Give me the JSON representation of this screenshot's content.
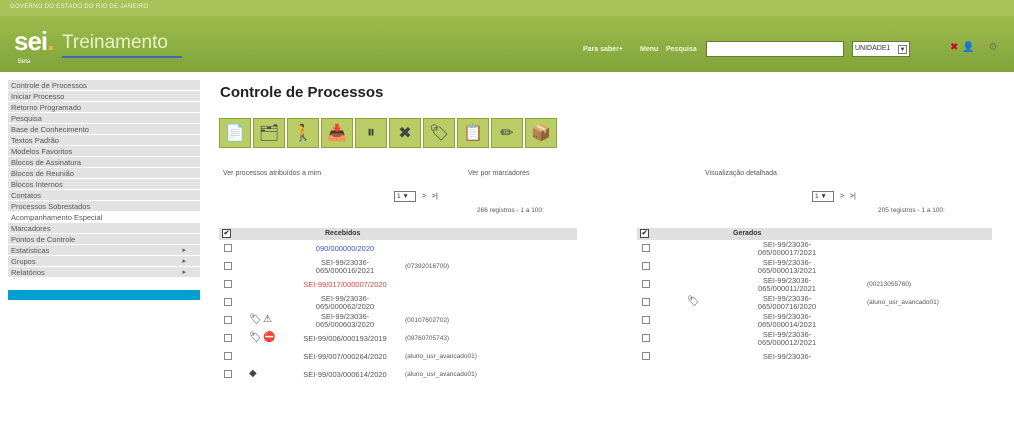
{
  "header": {
    "top_strip_text": "GOVERNO DO ESTADO DO RIO DE JANEIRO",
    "logo": "sei",
    "logo_dot": ".",
    "app_name": "Treinamento",
    "env": "Beta",
    "links": [
      "Para saber+",
      "Menu",
      "Pesquisa"
    ],
    "search": {
      "value": "",
      "placeholder": ""
    },
    "unit": "UNIDADE1",
    "icons": [
      "close-icon",
      "user-icon",
      "help-icon",
      "settings-icon"
    ]
  },
  "sidebar": {
    "items": [
      {
        "label": "Controle de Processos",
        "has_submenu": false
      },
      {
        "label": "Iniciar Processo",
        "has_submenu": false
      },
      {
        "label": "Retorno Programado",
        "has_submenu": false
      },
      {
        "label": "Pesquisa",
        "has_submenu": false
      },
      {
        "label": "Base de Conhecimento",
        "has_submenu": false
      },
      {
        "label": "Textos Padrão",
        "has_submenu": false
      },
      {
        "label": "Modelos Favoritos",
        "has_submenu": false
      },
      {
        "label": "Blocos de Assinatura",
        "has_submenu": false
      },
      {
        "label": "Blocos de Reunião",
        "has_submenu": false
      },
      {
        "label": "Blocos Internos",
        "has_submenu": false
      },
      {
        "label": "Contatos",
        "has_submenu": false
      },
      {
        "label": "Processos Sobrestados",
        "has_submenu": false
      },
      {
        "label": "Acompanhamento Especial",
        "has_submenu": false,
        "active": true
      },
      {
        "label": "Marcadores",
        "has_submenu": false
      },
      {
        "label": "Pontos de Controle",
        "has_submenu": false
      },
      {
        "label": "Estatísticas",
        "has_submenu": true
      },
      {
        "label": "Grupos",
        "has_submenu": true
      },
      {
        "label": "Relatórios",
        "has_submenu": true
      }
    ]
  },
  "main": {
    "title": "Controle de Processos",
    "toolbar": [
      "📄",
      "🗂",
      "🚶",
      "📥",
      "⏸",
      "✖",
      "🏷",
      "📋",
      "✏",
      "📦"
    ],
    "view_links": {
      "assigned": "Ver processos atribuídos a mim",
      "markers": "Ver por marcadores",
      "detailed": "Visualização detalhada"
    },
    "received": {
      "page": "1",
      "next": ">",
      "last": ">|",
      "count": "266 registros - 1 a 100:",
      "header": "Recebidos",
      "rows": [
        {
          "line1": "090/000000/2020",
          "line2": "",
          "style": "blue",
          "icons": [],
          "note": ""
        },
        {
          "line1": "SEI-99/23036-",
          "line2": "065/000016/2021",
          "style": "",
          "icons": [],
          "note": "(07392016700)"
        },
        {
          "line1": "SEI-99/017/000007/2020",
          "line2": "",
          "style": "red",
          "icons": [],
          "note": ""
        },
        {
          "line1": "SEI-99/23036-",
          "line2": "065/000062/2020",
          "style": "",
          "icons": [],
          "note": ""
        },
        {
          "line1": "SEI-99/23036-",
          "line2": "065/000603/2020",
          "style": "",
          "icons": [
            "🏷",
            "⚠"
          ],
          "note": "(00107602702)"
        },
        {
          "line1": "SEI-99/006/000193/2019",
          "line2": "",
          "style": "single",
          "icons": [
            "🏷",
            "⛔"
          ],
          "note": "(09760705743)"
        },
        {
          "line1": "SEI-99/007/000264/2020",
          "line2": "",
          "style": "single",
          "icons": [],
          "note": "(aluno_usr_avancado01)"
        },
        {
          "line1": "SEI-99/003/000614/2020",
          "line2": "",
          "style": "single",
          "icons": [
            "◆"
          ],
          "note": "(aluno_usr_avancado01)"
        }
      ]
    },
    "generated": {
      "page": "1",
      "next": ">",
      "last": ">|",
      "count": "205 registros - 1 a 100:",
      "header": "Gerados",
      "rows": [
        {
          "line1": "SEI-99/23036-",
          "line2": "065/000017/2021",
          "icons": [],
          "note": ""
        },
        {
          "line1": "SEI-99/23036-",
          "line2": "065/000013/2021",
          "icons": [],
          "note": ""
        },
        {
          "line1": "SEI-99/23036-",
          "line2": "065/000011/2021",
          "icons": [],
          "note": "(00213055760)"
        },
        {
          "line1": "SEI-99/23036-",
          "line2": "065/000716/2020",
          "icons": [
            "🏷"
          ],
          "note": "(aluno_usr_avancado01)"
        },
        {
          "line1": "SEI-99/23036-",
          "line2": "065/000014/2021",
          "icons": [],
          "note": ""
        },
        {
          "line1": "SEI-99/23036-",
          "line2": "065/000012/2021",
          "icons": [],
          "note": ""
        },
        {
          "line1": "SEI-99/23036-",
          "line2": "",
          "icons": [],
          "note": ""
        }
      ]
    }
  }
}
